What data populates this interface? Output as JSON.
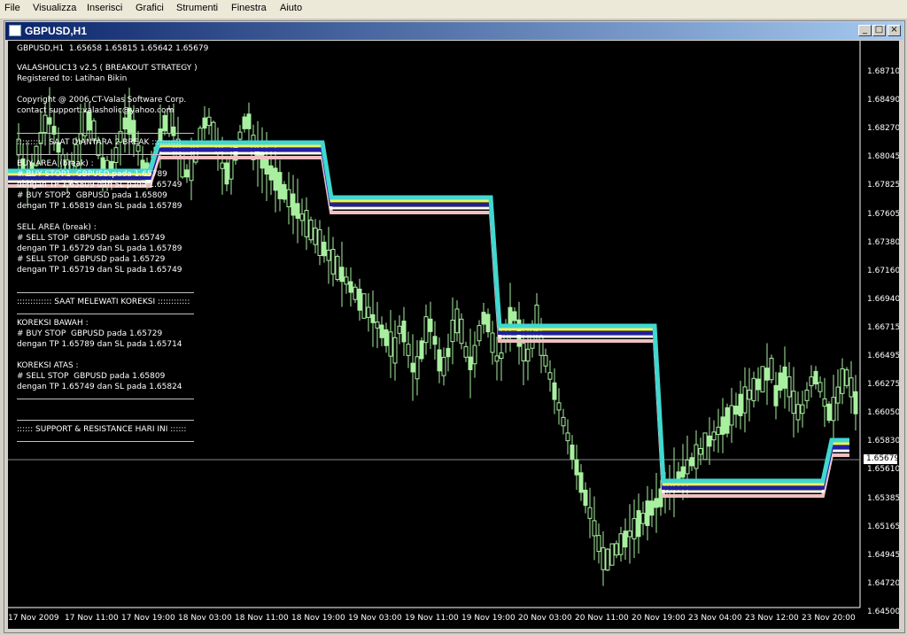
{
  "menu": [
    "File",
    "Visualizza",
    "Inserisci",
    "Grafici",
    "Strumenti",
    "Finestra",
    "Aiuto"
  ],
  "window": {
    "title": "GBPUSD,H1",
    "btn_min": "_",
    "btn_max": "□",
    "btn_close": "×"
  },
  "chart": {
    "header": "GBPUSD,H1  1.65658 1.65815 1.65642 1.65679",
    "lines": [
      "VALASHOLIC13 v2.5 ( BREAKOUT STRATEGY )",
      "Registered to: Latihan Bikin",
      "",
      "Copyright @ 2006,CT-Valas Software Corp.",
      "contact support:valasholic@yahoo.com"
    ],
    "section1": "::::::::::: SAAT DIANTARA 2 BREAK :::::::::::",
    "buy_area": [
      "BUY AREA (break) :",
      "# BUY STOP1  GBPUSD pada 1.65789",
      "dengan TP 1.65809 dan SL pada 1.65749",
      "# BUY STOP2  GBPUSD pada 1.65809",
      "dengan TP 1.65819 dan SL pada 1.65789"
    ],
    "sell_area": [
      "SELL AREA (break) :",
      "# SELL STOP  GBPUSD pada 1.65749",
      "dengan TP 1.65729 dan SL pada 1.65789",
      "# SELL STOP  GBPUSD pada 1.65729",
      "dengan TP 1.65719 dan SL pada 1.65749"
    ],
    "section2": "::::::::::::: SAAT MELEWATI KOREKSI ::::::::::::",
    "koreksi_bawah": [
      "KOREKSI BAWAH :",
      "# BUY STOP  GBPUSD pada 1.65729",
      "dengan TP 1.65789 dan SL pada 1.65714"
    ],
    "koreksi_atas": [
      "KOREKSI ATAS :",
      "# SELL STOP  GBPUSD pada 1.65809",
      "dengan TP 1.65749 dan SL pada 1.65824"
    ],
    "section3": ":::::: SUPPORT & RESISTANCE HARI INI ::::::",
    "current_price": "1.65679",
    "y_ticks": [
      "1.68710",
      "1.68490",
      "1.68270",
      "1.68045",
      "1.67825",
      "1.67605",
      "1.67380",
      "1.67160",
      "1.66940",
      "1.66715",
      "1.66495",
      "1.66275",
      "1.66050",
      "1.65830",
      "1.65610",
      "1.65385",
      "1.65165",
      "1.64945",
      "1.64720",
      "1.64500"
    ],
    "x_ticks": [
      "17 Nov 2009",
      "17 Nov 11:00",
      "17 Nov 19:00",
      "18 Nov 03:00",
      "18 Nov 11:00",
      "18 Nov 19:00",
      "19 Nov 03:00",
      "19 Nov 11:00",
      "19 Nov 19:00",
      "20 Nov 03:00",
      "20 Nov 11:00",
      "20 Nov 19:00",
      "23 Nov 04:00",
      "23 Nov 12:00",
      "23 Nov 20:00"
    ],
    "colors": {
      "bull": "#a8f0a0",
      "band_cyan": "#40d8d0",
      "band_yellow": "#f0f060",
      "band_blue": "#2020a0",
      "band_pink": "#f0c0c0",
      "band_white": "#ffffff"
    }
  }
}
